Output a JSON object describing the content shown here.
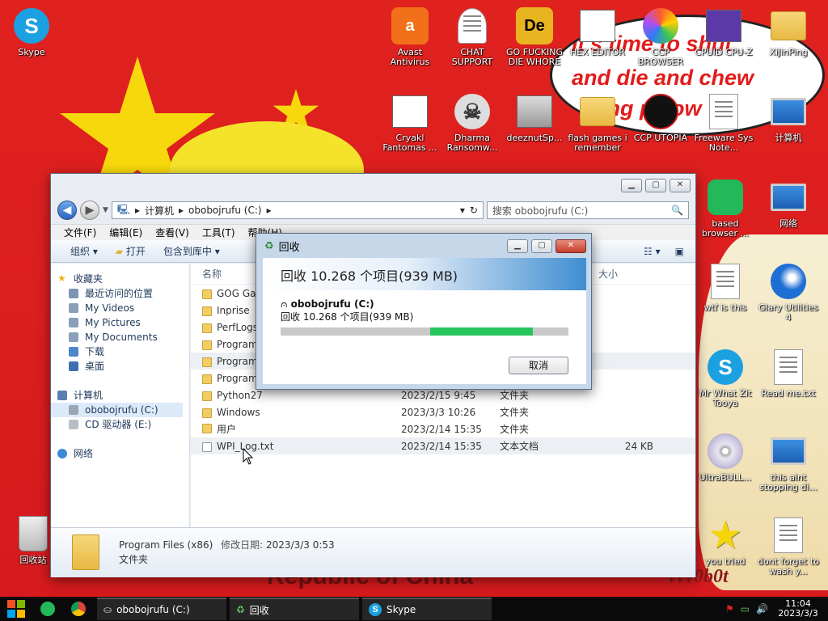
{
  "desktop": {
    "icons": [
      {
        "label": "Skype",
        "icon": "skype-icon"
      },
      {
        "label": "Avast Antivirus",
        "icon": "avast-icon"
      },
      {
        "label": "CHAT SUPPORT",
        "icon": "support-agent-icon"
      },
      {
        "label": "GO FUCKING DIE WHORE",
        "icon": "app-icon"
      },
      {
        "label": "HEX EDITOR",
        "icon": "hex-editor-icon"
      },
      {
        "label": "CCP BROWSER",
        "icon": "browser-icon"
      },
      {
        "label": "CPUID CPU-Z",
        "icon": "cpuz-icon"
      },
      {
        "label": "XiJinPing",
        "icon": "user-icon"
      },
      {
        "label": "Cryakl Fantomas ...",
        "icon": "program-icon"
      },
      {
        "label": "Dharma Ransomw...",
        "icon": "skull-icon"
      },
      {
        "label": "deeznutSp...",
        "icon": "windows-stack-icon"
      },
      {
        "label": "flash games i remember",
        "icon": "folder-icon"
      },
      {
        "label": "CCP UTOPIA",
        "icon": "game-icon"
      },
      {
        "label": "Freeware Sys Note...",
        "icon": "document-icon"
      },
      {
        "label": "计算机",
        "icon": "computer-icon"
      },
      {
        "label": "based browser ...",
        "icon": "browser-green-icon"
      },
      {
        "label": "网络",
        "icon": "network-icon"
      },
      {
        "label": "wtf is this",
        "icon": "document-icon"
      },
      {
        "label": "Glary Utilities 4",
        "icon": "glary-icon"
      },
      {
        "label": "Mr What Zit Tooya",
        "icon": "skype-icon"
      },
      {
        "label": "Read me.txt",
        "icon": "text-file-icon"
      },
      {
        "label": "UltraBULL...",
        "icon": "disc-icon"
      },
      {
        "label": "this aint stopping di...",
        "icon": "installer-icon"
      },
      {
        "label": "you tried",
        "icon": "star-icon"
      },
      {
        "label": "dont forget to wash y...",
        "icon": "document-icon"
      },
      {
        "label": "回收站",
        "icon": "recycle-bin-icon"
      }
    ],
    "wallpaper": {
      "bubble_line1": "It's time to shut",
      "bubble_line2": "and die and chew",
      "bubble_line3": "ing pillow",
      "bottom_text": "Republic of China",
      "signature": "vvv0b0t"
    }
  },
  "explorer": {
    "title": "",
    "address": {
      "root_label": "计算机",
      "drive_label": "obobojrufu (C:)"
    },
    "search_placeholder": "搜索 obobojrufu (C:)",
    "menu": [
      "文件(F)",
      "编辑(E)",
      "查看(V)",
      "工具(T)",
      "帮助(H)"
    ],
    "toolbar": {
      "organize": "组织 ▾",
      "open": "打开",
      "include": "包含到库中 ▾"
    },
    "nav": {
      "favorites": "收藏夹",
      "fav_items": [
        "最近访问的位置",
        "My Videos",
        "My Pictures",
        "My Documents",
        "下载",
        "桌面"
      ],
      "computer": "计算机",
      "computer_items": [
        "obobojrufu (C:)",
        "CD 驱动器 (E:)"
      ],
      "network": "网络"
    },
    "columns": {
      "name": "名称",
      "size": "大小"
    },
    "rows": [
      {
        "name": "GOG Games",
        "date": "",
        "type": "",
        "size": ""
      },
      {
        "name": "Inprise",
        "date": "",
        "type": "",
        "size": ""
      },
      {
        "name": "PerfLogs",
        "date": "",
        "type": "",
        "size": ""
      },
      {
        "name": "Program Files",
        "date": "",
        "type": "",
        "size": ""
      },
      {
        "name": "Program Files (x86)",
        "date": "",
        "type": "",
        "size": ""
      },
      {
        "name": "ProgramData",
        "date": "",
        "type": "",
        "size": ""
      },
      {
        "name": "Python27",
        "date": "2023/2/15 9:45",
        "type": "文件夹",
        "size": ""
      },
      {
        "name": "Windows",
        "date": "2023/3/3 10:26",
        "type": "文件夹",
        "size": ""
      },
      {
        "name": "用户",
        "date": "2023/2/14 15:35",
        "type": "文件夹",
        "size": ""
      },
      {
        "name": "WPI_Log.txt",
        "date": "2023/2/14 15:35",
        "type": "文本文档",
        "size": "24 KB"
      }
    ],
    "details": {
      "name": "Program Files (x86)",
      "modified_label": "修改日期:",
      "modified": "2023/3/3 0:53",
      "kind": "文件夹"
    }
  },
  "recycle_dialog": {
    "title": "回收",
    "banner": "回收 10.268 个项目(939 MB)",
    "drive": "obobojrufu (C:)",
    "status": "回收 10.268 个项目(939 MB)",
    "progress_segment_start": 0.52,
    "progress_segment_end": 0.877,
    "progress_color": "#26c65c",
    "cancel_label": "取消"
  },
  "taskbar": {
    "items": [
      {
        "label": "obobojrufu (C:)",
        "icon": "folder-drive-icon"
      },
      {
        "label": "回收",
        "icon": "recycle-icon"
      },
      {
        "label": "Skype",
        "icon": "skype-icon"
      }
    ],
    "time": "11:04",
    "date": "2023/3/3"
  },
  "colors": {
    "desktop_red": "#d61a1e",
    "star_yellow": "#f6d80c",
    "explorer_frame": "#e9edf3"
  }
}
